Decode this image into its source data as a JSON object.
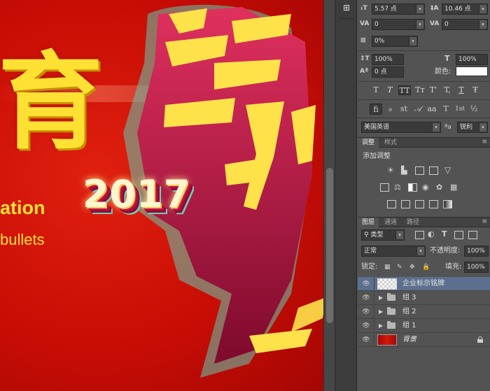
{
  "canvas": {
    "big_char": "育",
    "tag_line1": "ation",
    "tag_line2": "bullets",
    "year": "2017"
  },
  "character_panel": {
    "font_size": "5.57 点",
    "leading": "10.46 点",
    "kerning": "0",
    "tracking": "0",
    "baseline_percent": "0%",
    "vertical_scale": "100%",
    "horizontal_scale": "100%",
    "baseline_shift": "0 点",
    "color_label": "颜色:",
    "color_swatch": "#ffffff",
    "type_styles": [
      "T",
      "T",
      "TT",
      "Tт",
      "T'",
      "T,",
      "T",
      "Ŧ"
    ],
    "opentype_styles": [
      "fi",
      "ℴ",
      "st",
      "𝒜",
      "aa",
      "T",
      "1st",
      "½"
    ],
    "language": "美国英语",
    "aa_icon": "ªa",
    "antialias": "锐利"
  },
  "adjust_panel": {
    "tabs": [
      "调整",
      "样式"
    ],
    "title": "添加调整"
  },
  "layers_panel": {
    "tabs": [
      "图层",
      "通道",
      "路径"
    ],
    "filter": "类型",
    "blend_mode": "正常",
    "opacity_label": "不透明度:",
    "opacity": "100%",
    "lock_label": "锁定:",
    "fill_label": "填充:",
    "fill": "100%",
    "layers": [
      {
        "name": "企业标示铭牌",
        "type": "smart",
        "selected": true
      },
      {
        "name": "组 3",
        "type": "group"
      },
      {
        "name": "组 2",
        "type": "group"
      },
      {
        "name": "组 1",
        "type": "group"
      },
      {
        "name": "背景",
        "type": "background",
        "locked": true
      }
    ]
  }
}
